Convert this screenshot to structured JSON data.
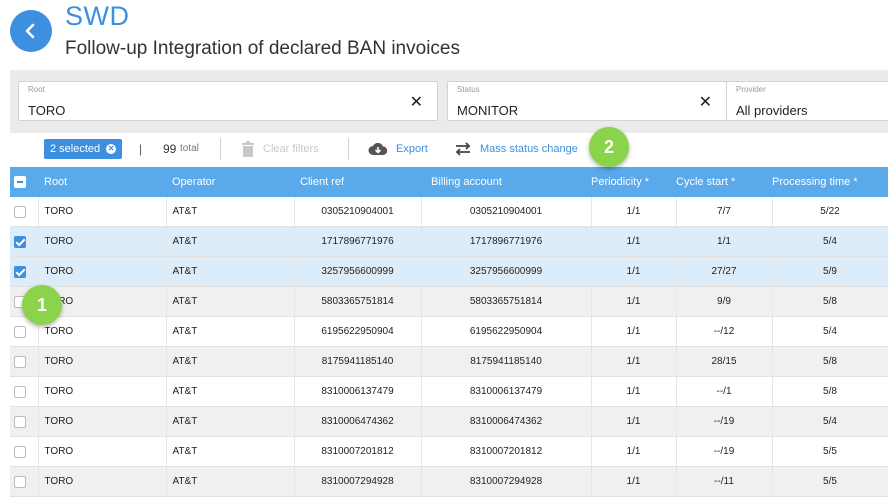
{
  "header": {
    "app_name": "SWD",
    "page_title": "Follow-up Integration of declared BAN invoices"
  },
  "filters": [
    {
      "label": "Root",
      "value": "TORO",
      "clearable": true
    },
    {
      "label": "Status",
      "value": "MONITOR",
      "clearable": true
    },
    {
      "label": "Provider",
      "value": "All providers",
      "clearable": false
    }
  ],
  "toolbar": {
    "selected_label": "2 selected",
    "separator": "|",
    "total_count": "99",
    "total_label": "total",
    "clear_filters_label": "Clear filters",
    "export_label": "Export",
    "mass_status_label": "Mass status change"
  },
  "badges": [
    "1",
    "2"
  ],
  "table": {
    "columns": [
      "Root",
      "Operator",
      "Client ref",
      "Billing account",
      "Periodicity *",
      "Cycle start *",
      "Processing time *"
    ],
    "rows": [
      {
        "checked": false,
        "root": "TORO",
        "operator": "AT&T",
        "client_ref": "0305210904001",
        "billing_account": "0305210904001",
        "periodicity": "1/1",
        "cycle_start": "7/7",
        "processing_time": "5/22"
      },
      {
        "checked": true,
        "root": "TORO",
        "operator": "AT&T",
        "client_ref": "1717896771976",
        "billing_account": "1717896771976",
        "periodicity": "1/1",
        "cycle_start": "1/1",
        "processing_time": "5/4"
      },
      {
        "checked": true,
        "root": "TORO",
        "operator": "AT&T",
        "client_ref": "3257956600999",
        "billing_account": "3257956600999",
        "periodicity": "1/1",
        "cycle_start": "27/27",
        "processing_time": "5/9"
      },
      {
        "checked": false,
        "root": "TORO",
        "operator": "AT&T",
        "client_ref": "5803365751814",
        "billing_account": "5803365751814",
        "periodicity": "1/1",
        "cycle_start": "9/9",
        "processing_time": "5/8"
      },
      {
        "checked": false,
        "root": "TORO",
        "operator": "AT&T",
        "client_ref": "6195622950904",
        "billing_account": "6195622950904",
        "periodicity": "1/1",
        "cycle_start": "--/12",
        "processing_time": "5/4"
      },
      {
        "checked": false,
        "root": "TORO",
        "operator": "AT&T",
        "client_ref": "8175941185140",
        "billing_account": "8175941185140",
        "periodicity": "1/1",
        "cycle_start": "28/15",
        "processing_time": "5/8"
      },
      {
        "checked": false,
        "root": "TORO",
        "operator": "AT&T",
        "client_ref": "8310006137479",
        "billing_account": "8310006137479",
        "periodicity": "1/1",
        "cycle_start": "--/1",
        "processing_time": "5/8"
      },
      {
        "checked": false,
        "root": "TORO",
        "operator": "AT&T",
        "client_ref": "8310006474362",
        "billing_account": "8310006474362",
        "periodicity": "1/1",
        "cycle_start": "--/19",
        "processing_time": "5/4"
      },
      {
        "checked": false,
        "root": "TORO",
        "operator": "AT&T",
        "client_ref": "8310007201812",
        "billing_account": "8310007201812",
        "periodicity": "1/1",
        "cycle_start": "--/19",
        "processing_time": "5/5"
      },
      {
        "checked": false,
        "root": "TORO",
        "operator": "AT&T",
        "client_ref": "8310007294928",
        "billing_account": "8310007294928",
        "periodicity": "1/1",
        "cycle_start": "--/11",
        "processing_time": "5/5"
      }
    ]
  },
  "colors": {
    "accent": "#3d8fe0",
    "header_row": "#5aa9ea",
    "badge": "#8bd34a",
    "selected_row": "#dcecf8"
  }
}
